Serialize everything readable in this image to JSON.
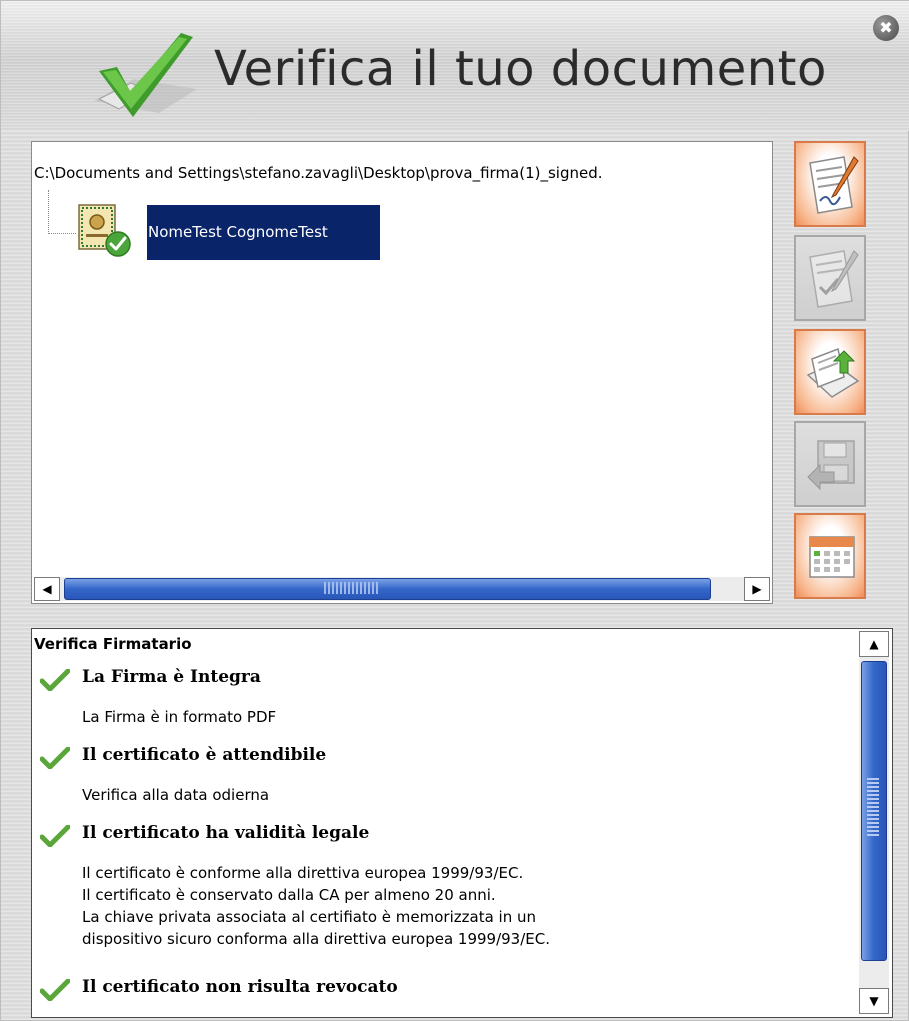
{
  "window": {
    "title": "Verifica il tuo documento",
    "close_symbol": "✖"
  },
  "tree": {
    "path": "C:\\Documents and Settings\\stefano.zavagli\\Desktop\\prova_firma(1)_signed.",
    "signer_node_label": "NomeTest CognomeTest",
    "signer_icon": "certificate-check-icon"
  },
  "toolbar": {
    "buttons": [
      {
        "name": "sign-document-icon",
        "state": "active"
      },
      {
        "name": "countersign-icon",
        "state": "disabled"
      },
      {
        "name": "envelope-export-icon",
        "state": "active"
      },
      {
        "name": "save-floppy-icon",
        "state": "disabled"
      },
      {
        "name": "calendar-icon",
        "state": "active"
      }
    ]
  },
  "scrollbar": {
    "left_arrow": "◀",
    "right_arrow": "▶",
    "up_arrow": "▲",
    "down_arrow": "▼"
  },
  "status": {
    "heading": "Verifica Firmatario",
    "items": [
      {
        "title": "La Firma è Integra",
        "details": [
          "La Firma è in formato PDF"
        ]
      },
      {
        "title": "Il certificato è attendibile",
        "details": [
          "Verifica alla data odierna"
        ]
      },
      {
        "title": "Il certificato ha validità legale",
        "details": [
          "Il certificato è conforme alla direttiva europea 1999/93/EC.",
          "Il certificato è conservato dalla CA per almeno 20 anni.",
          "La chiave privata associata al certifiato è memorizzata in un",
          "dispositivo sicuro conforma alla direttiva europea 1999/93/EC."
        ]
      },
      {
        "title": "Il certificato non risulta revocato",
        "details": []
      }
    ]
  },
  "colors": {
    "selection": "#0a246a",
    "accent_orange": "#ef8e5a",
    "check_green": "#5aa63a",
    "scroll_blue": "#3466c9"
  }
}
